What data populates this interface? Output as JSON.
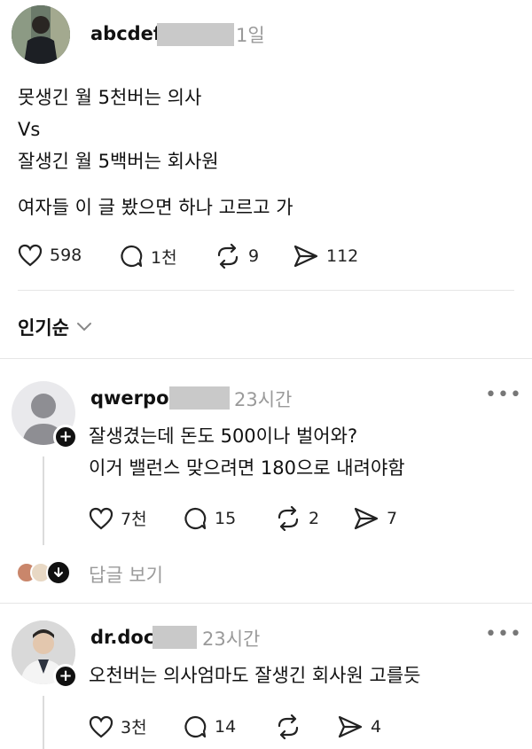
{
  "post": {
    "username": "abcdef",
    "time": "1일",
    "lines": [
      "못생긴 월 5천버는 의사",
      "Vs",
      "잘생긴 월 5백버는 회사원"
    ],
    "line2": "여자들 이 글 봤으면 하나 고르고 가",
    "likes": "598",
    "comments": "1천",
    "reposts": "9",
    "shares": "112"
  },
  "sort": {
    "label": "인기순"
  },
  "comments": [
    {
      "username": "qwerpoi",
      "time": "23시간",
      "lines": [
        "잘생겼는데 돈도 500이나 벌어와?",
        "이거 밸런스 맞으려면 180으로 내려야함"
      ],
      "likes": "7천",
      "comments": "15",
      "reposts": "2",
      "shares": "7",
      "replies_label": "답글 보기"
    },
    {
      "username": "dr.doc",
      "time": "23시간",
      "lines": [
        "오천버는 의사엄마도 잘생긴 회사원 고를듯"
      ],
      "likes": "3천",
      "comments": "14",
      "reposts": "",
      "shares": "4"
    }
  ],
  "colors": {
    "text": "#111111",
    "muted": "#9a9a9a",
    "redaction": "#c9c9c9",
    "divider": "#e6e6e6"
  }
}
